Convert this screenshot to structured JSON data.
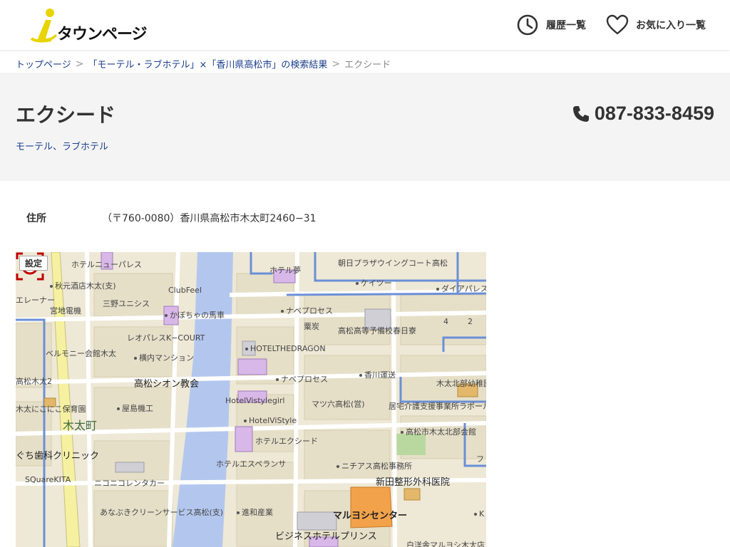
{
  "header": {
    "logo_text": "タウンページ",
    "history_label": "履歴一覧",
    "favorites_label": "お気に入り一覧"
  },
  "breadcrumb": {
    "top": "トップページ",
    "search": "「モーテル・ラブホテル」×「香川県高松市」の検索結果",
    "current": "エクシード",
    "separator": ">"
  },
  "listing": {
    "name": "エクシード",
    "category": "モーテル、ラブホテル",
    "phone": "087-833-8459"
  },
  "address": {
    "label": "住所",
    "value": "（〒760-0080）香川県高松市木太町2460−31"
  },
  "map": {
    "settings_label": "設定",
    "labels": {
      "l1": "ホテルニューパレス",
      "l2": "秋元酒店木太(支)",
      "l3": "ClubFeel",
      "l4": "ホテル夢",
      "l5": "朝日プラザウイングコート高松",
      "l6": "ケイツー",
      "l7": "ダイアパレス",
      "l8": "宮地電機",
      "l9": "三野ユニシス",
      "l10": "かぼちゃの馬車",
      "l11": "ナベプロセス",
      "l12": "粟炭",
      "l13": "高松高等予備校春日寮",
      "l14": "レオパレスK−COURT",
      "l15": "ベルモニー会館木太",
      "l16": "横内マンション",
      "l17": "HOTELTHEDRAGON",
      "l18": "香川運送",
      "l19": "ナベプロセス",
      "l20": "木太北部幼稚園",
      "l21": "高松シオン教会",
      "l22": "高松木太2",
      "l23": "HotelVistylegirl",
      "l24": "マツ六高松(営)",
      "l25": "居宅介護支援事業所ラポール",
      "l26": "木太にこにこ保育園",
      "l27": "屋島機工",
      "l28": "HotelViStyle",
      "l29": "木太町",
      "l30": "高松市木太北部会館",
      "l31": "ホテルエクシード",
      "l32": "ぐち歯科クリニック",
      "l33": "ホテルエスペランサ",
      "l34": "ニチアス高松事務所",
      "l35": "SQuareKITA",
      "l36": "ニコニコレンタカー",
      "l37": "新田整形外科医院",
      "l38": "あなぶきクリーンサービス高松(支)",
      "l39": "進和産業",
      "l40": "マルヨシセンター",
      "l41": "ビジネスホテルプリンス",
      "l42": "白洋舎マルヨシ木太店",
      "l43": "エレーナー",
      "l44": "4",
      "l45": "2",
      "l46": "K",
      "l47": "フ"
    }
  }
}
